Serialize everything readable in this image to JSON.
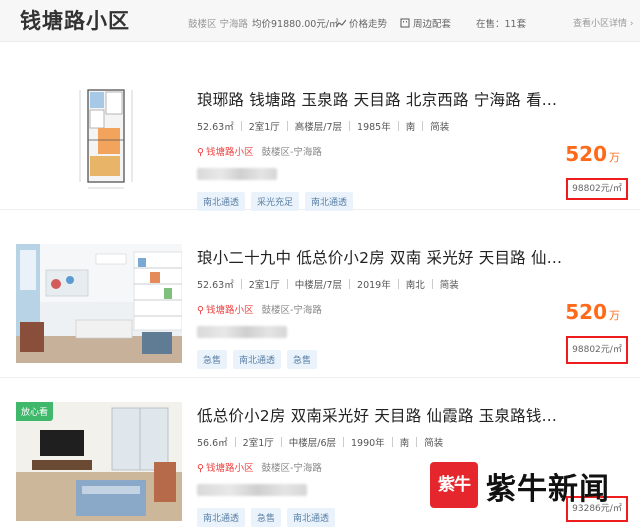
{
  "header": {
    "title": "钱塘路小区",
    "location": "鼓楼区 宁海路",
    "avg_price": "均价91880.00元/㎡",
    "price_trend": "价格走势",
    "nearby": "周边配套",
    "on_sale": "在售：11套",
    "detail_link": "查看小区详情 ›"
  },
  "listings": [
    {
      "title": "琅琊路 钱塘路 玉泉路 天目路 北京西路 宁海路 看...",
      "area": "52.63㎡",
      "layout": "2室1厅",
      "floor": "高楼层/7层",
      "year": "1985年",
      "orientation": "南",
      "decoration": "简装",
      "community": "钱塘路小区",
      "district": "鼓楼区-宁海路",
      "tags": [
        "南北通透",
        "采光充足",
        "南北通透"
      ],
      "price": "520",
      "price_unit": "万",
      "unit_price": "98802元/㎡",
      "image": "floorplan"
    },
    {
      "title": "琅小二十九中 低总价小2房 双南 采光好 天目路 仙...",
      "area": "52.63㎡",
      "layout": "2室1厅",
      "floor": "中楼层/7层",
      "year": "2019年",
      "orientation": "南北",
      "decoration": "简装",
      "community": "钱塘路小区",
      "district": "鼓楼区-宁海路",
      "tags": [
        "急售",
        "南北通透",
        "急售"
      ],
      "price": "520",
      "price_unit": "万",
      "unit_price": "98802元/㎡",
      "image": "kids-room-photo"
    },
    {
      "title": "低总价小2房 双南采光好 天目路 仙霞路 玉泉路钱...",
      "area": "56.6㎡",
      "layout": "2室1厅",
      "floor": "中楼层/6层",
      "year": "1990年",
      "orientation": "南",
      "decoration": "简装",
      "community": "钱塘路小区",
      "district": "鼓楼区-宁海路",
      "tags": [
        "南北通透",
        "急售",
        "南北通透"
      ],
      "price": "",
      "price_unit": "",
      "unit_price": "93286元/㎡",
      "badge": "放心看",
      "image": "living-room-photo"
    }
  ],
  "watermark": {
    "logo_text": "紫牛",
    "brand_text": "紫牛新闻"
  },
  "colors": {
    "price": "#ff6a1a",
    "highlight_border": "#ee1c1c",
    "community_link": "#e44444",
    "tag_bg": "#eaf3fb",
    "tag_text": "#5a7fa6",
    "safe_badge": "#3fb86b",
    "watermark_red": "#e5262d"
  }
}
